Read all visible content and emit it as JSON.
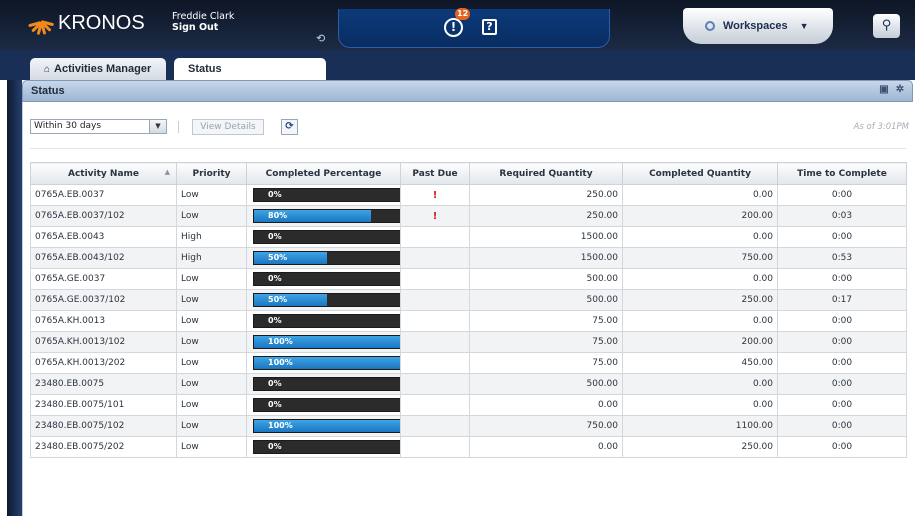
{
  "header": {
    "logo_text": "KRONOS",
    "user_name": "Freddie Clark",
    "sign_out": "Sign Out",
    "alert_count": "12",
    "alert_symbol": "!",
    "help_symbol": "?",
    "workspaces_label": "Workspaces",
    "colors": {
      "brand_orange": "#f08a1c",
      "header_bg": "#0e1626",
      "band_blue": "#0b3a7a",
      "badge": "#e8641c"
    }
  },
  "tabs": [
    {
      "label": "Activities Manager",
      "icon": "home-icon"
    },
    {
      "label": "Status"
    }
  ],
  "panel": {
    "title": "Status",
    "filter": {
      "selected": "Within 30 days"
    },
    "view_details": "View Details",
    "as_of": "As of 3:01PM"
  },
  "table": {
    "columns": [
      "Activity Name",
      "Priority",
      "Completed Percentage",
      "Past Due",
      "Required Quantity",
      "Completed Quantity",
      "Time to Complete"
    ],
    "rows": [
      {
        "name": "0765A.EB.0037",
        "priority": "Low",
        "pct": "0%",
        "pct_value": 0,
        "past_due": "!",
        "required": "250.00",
        "completed": "0.00",
        "time": "0:00"
      },
      {
        "name": "0765A.EB.0037/102",
        "priority": "Low",
        "pct": "80%",
        "pct_value": 80,
        "past_due": "!",
        "required": "250.00",
        "completed": "200.00",
        "time": "0:03"
      },
      {
        "name": "0765A.EB.0043",
        "priority": "High",
        "pct": "0%",
        "pct_value": 0,
        "past_due": "",
        "required": "1500.00",
        "completed": "0.00",
        "time": "0:00"
      },
      {
        "name": "0765A.EB.0043/102",
        "priority": "High",
        "pct": "50%",
        "pct_value": 50,
        "past_due": "",
        "required": "1500.00",
        "completed": "750.00",
        "time": "0:53"
      },
      {
        "name": "0765A.GE.0037",
        "priority": "Low",
        "pct": "0%",
        "pct_value": 0,
        "past_due": "",
        "required": "500.00",
        "completed": "0.00",
        "time": "0:00"
      },
      {
        "name": "0765A.GE.0037/102",
        "priority": "Low",
        "pct": "50%",
        "pct_value": 50,
        "past_due": "",
        "required": "500.00",
        "completed": "250.00",
        "time": "0:17"
      },
      {
        "name": "0765A.KH.0013",
        "priority": "Low",
        "pct": "0%",
        "pct_value": 0,
        "past_due": "",
        "required": "75.00",
        "completed": "0.00",
        "time": "0:00"
      },
      {
        "name": "0765A.KH.0013/102",
        "priority": "Low",
        "pct": "100%",
        "pct_value": 100,
        "past_due": "",
        "required": "75.00",
        "completed": "200.00",
        "time": "0:00"
      },
      {
        "name": "0765A.KH.0013/202",
        "priority": "Low",
        "pct": "100%",
        "pct_value": 100,
        "past_due": "",
        "required": "75.00",
        "completed": "450.00",
        "time": "0:00"
      },
      {
        "name": "23480.EB.0075",
        "priority": "Low",
        "pct": "0%",
        "pct_value": 0,
        "past_due": "",
        "required": "500.00",
        "completed": "0.00",
        "time": "0:00"
      },
      {
        "name": "23480.EB.0075/101",
        "priority": "Low",
        "pct": "0%",
        "pct_value": 0,
        "past_due": "",
        "required": "0.00",
        "completed": "0.00",
        "time": "0:00"
      },
      {
        "name": "23480.EB.0075/102",
        "priority": "Low",
        "pct": "100%",
        "pct_value": 100,
        "past_due": "",
        "required": "750.00",
        "completed": "1100.00",
        "time": "0:00"
      },
      {
        "name": "23480.EB.0075/202",
        "priority": "Low",
        "pct": "0%",
        "pct_value": 0,
        "past_due": "",
        "required": "0.00",
        "completed": "250.00",
        "time": "0:00"
      }
    ]
  }
}
